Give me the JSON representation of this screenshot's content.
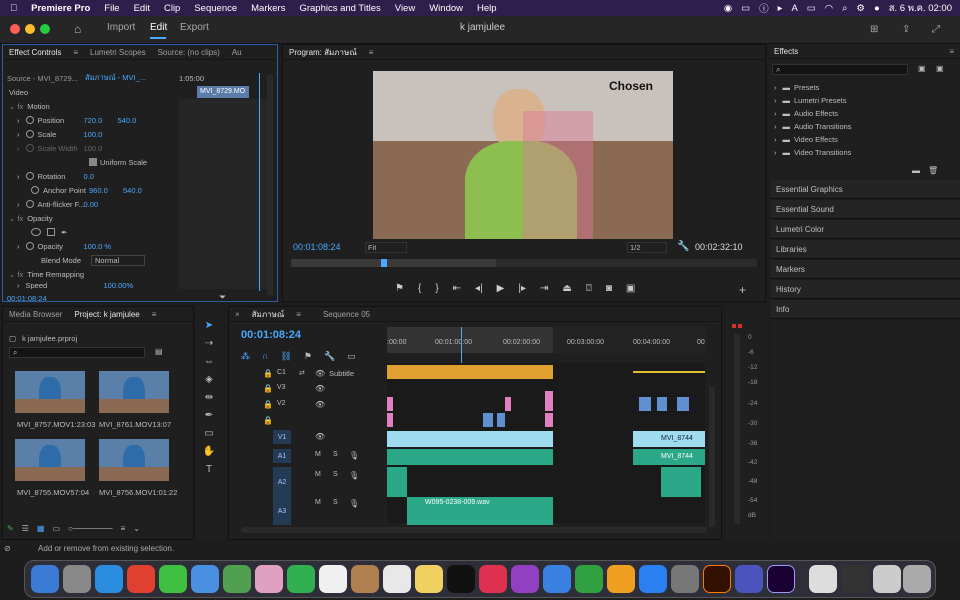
{
  "menubar": {
    "apple": "",
    "items": [
      "Premiere Pro",
      "File",
      "Edit",
      "Clip",
      "Sequence",
      "Markers",
      "Graphics and Titles",
      "View",
      "Window",
      "Help"
    ],
    "status": "ส. 6 พ.ค. 02:00"
  },
  "titlebar": {
    "workspaces": [
      "Import",
      "Edit",
      "Export"
    ],
    "title": "k jamjulee"
  },
  "effect_controls": {
    "tabs": [
      "Effect Controls",
      "Lumetri Scopes",
      "Source: (no clips)",
      "Au"
    ],
    "source_line": "Source - MVI_8729...",
    "seq_link": "สัมภาษณ์ - MVI_...",
    "timecode_top": "1:05:00",
    "clip_name": "MVI_8729.MO",
    "video": "Video",
    "motion": "Motion",
    "position": "Position",
    "pos_x": "720.0",
    "pos_y": "540.0",
    "scale": "Scale",
    "scale_v": "100.0",
    "scale_width": "Scale Width",
    "scale_width_v": "100.0",
    "uniform": "Uniform Scale",
    "rotation": "Rotation",
    "rotation_v": "0.0",
    "anchor": "Anchor Point",
    "anchor_x": "960.0",
    "anchor_y": "540.0",
    "antiflicker": "Anti-flicker F...",
    "antiflicker_v": "0.00",
    "opacity": "Opacity",
    "opacity_row": "Opacity",
    "opacity_v": "100.0 %",
    "blend": "Blend Mode",
    "blend_v": "Normal",
    "time_remap": "Time Remapping",
    "speed": "Speed",
    "speed_v": "100.00%",
    "timecode": "00:01:08:24"
  },
  "program": {
    "tab": "Program: สัมภาษณ์",
    "watermark": "Chosen",
    "timecode": "00:01:08:24",
    "fit": "Fit",
    "res": "1/2",
    "duration": "00:02:32:10"
  },
  "effects": {
    "title": "Effects",
    "folders": [
      "Presets",
      "Lumetri Presets",
      "Audio Effects",
      "Audio Transitions",
      "Video Effects",
      "Video Transitions"
    ],
    "panels": [
      "Essential Graphics",
      "Essential Sound",
      "Lumetri Color",
      "Libraries",
      "Markers",
      "History",
      "Info"
    ]
  },
  "project": {
    "tabs": [
      "Media Browser",
      "Project: k jamjulee"
    ],
    "file": "k jamjulee.prproj",
    "items": [
      {
        "name": "MVI_8757.MOV",
        "dur": "1:23:03"
      },
      {
        "name": "MVI_8761.MOV",
        "dur": "13:07"
      },
      {
        "name": "MVI_8755.MOV",
        "dur": "57:04"
      },
      {
        "name": "MVI_8756.MOV",
        "dur": "1:01:22"
      }
    ]
  },
  "timeline": {
    "tabs": [
      "สัมภาษณ์",
      "Sequence 05"
    ],
    "timecode": "00:01:08:24",
    "ruler": [
      ":00:00",
      "00:01:00:00",
      "00:02:00:00",
      "00:03:00:00",
      "00:04:00:00",
      "00"
    ],
    "tracks": [
      "C1",
      "V3",
      "V2",
      "V1",
      "A1",
      "A2",
      "A3"
    ],
    "subtitle": "Subtitle",
    "clip_v1": "MVI_8744",
    "clip_a1": "MVI_8744",
    "audio_clip": "W095-0238-009.wav",
    "ms": [
      "M",
      "S"
    ]
  },
  "meter": {
    "ticks": [
      "0",
      "-6",
      "-12",
      "-18",
      "-24",
      "-30",
      "-36",
      "-42",
      "-48",
      "-54",
      "dB"
    ]
  },
  "status": "Add or remove from existing selection."
}
